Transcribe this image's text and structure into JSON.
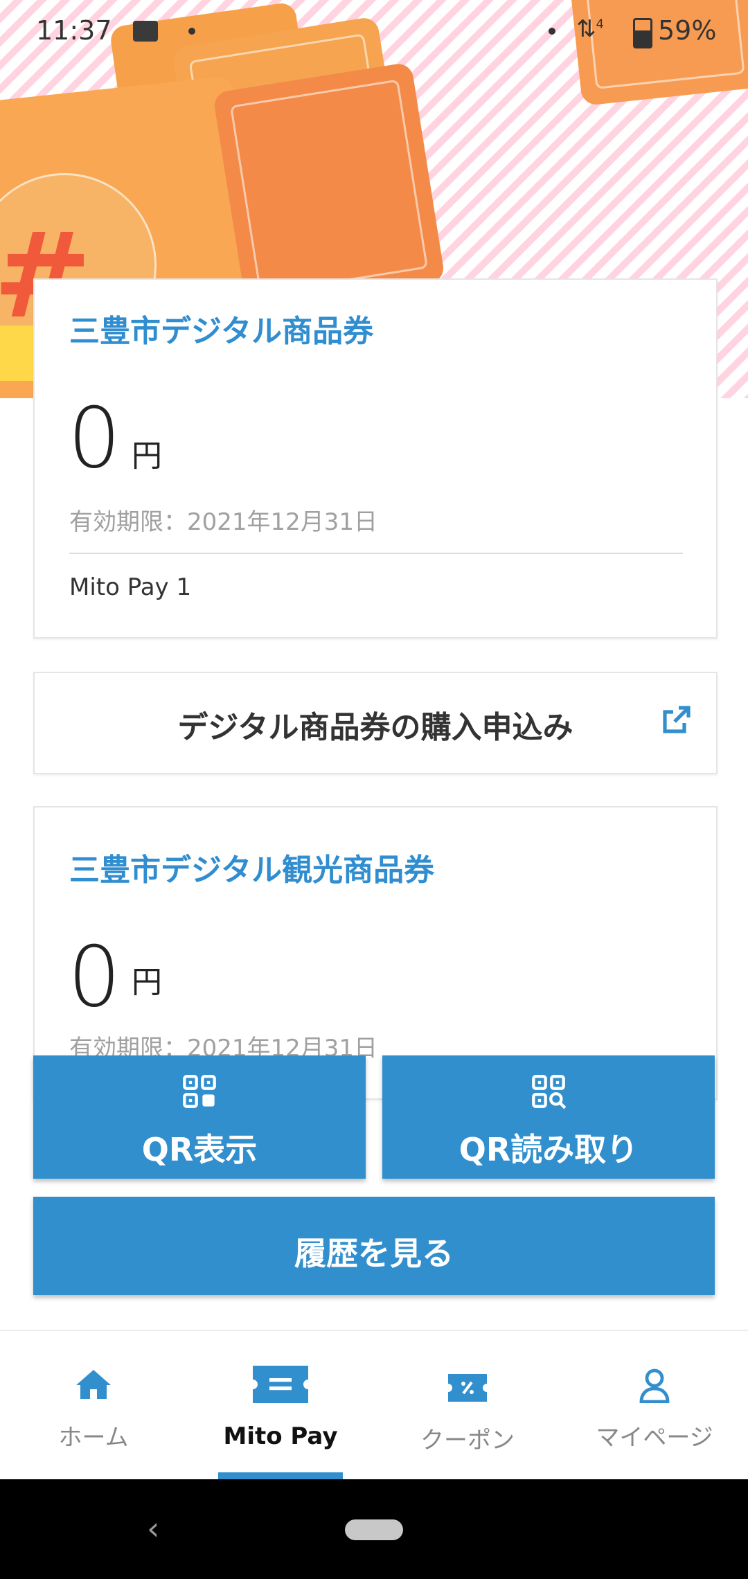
{
  "status_bar": {
    "time": "11:37",
    "battery": "59%",
    "network": "4"
  },
  "card_shopping": {
    "title": "三豊市デジタル商品券",
    "amount": "0",
    "currency": "円",
    "expiry": "有効期限：2021年12月31日",
    "subname": "Mito Pay 1"
  },
  "purchase": {
    "label": "デジタル商品券の購入申込み"
  },
  "card_tourism": {
    "title": "三豊市デジタル観光商品券",
    "amount": "0",
    "currency": "円",
    "expiry": "有効期限：2021年12月31日"
  },
  "actions": {
    "qr_show": "QR表示",
    "qr_read": "QR読み取り",
    "history": "履歴を見る"
  },
  "nav": {
    "items": [
      {
        "label": "ホーム",
        "icon": "home-icon"
      },
      {
        "label": "Mito Pay",
        "icon": "ticket-icon",
        "active": true
      },
      {
        "label": "クーポン",
        "icon": "coupon-icon"
      },
      {
        "label": "マイページ",
        "icon": "user-icon"
      }
    ]
  },
  "colors": {
    "accent": "#318fcd",
    "title_blue": "#2f8dd0"
  }
}
